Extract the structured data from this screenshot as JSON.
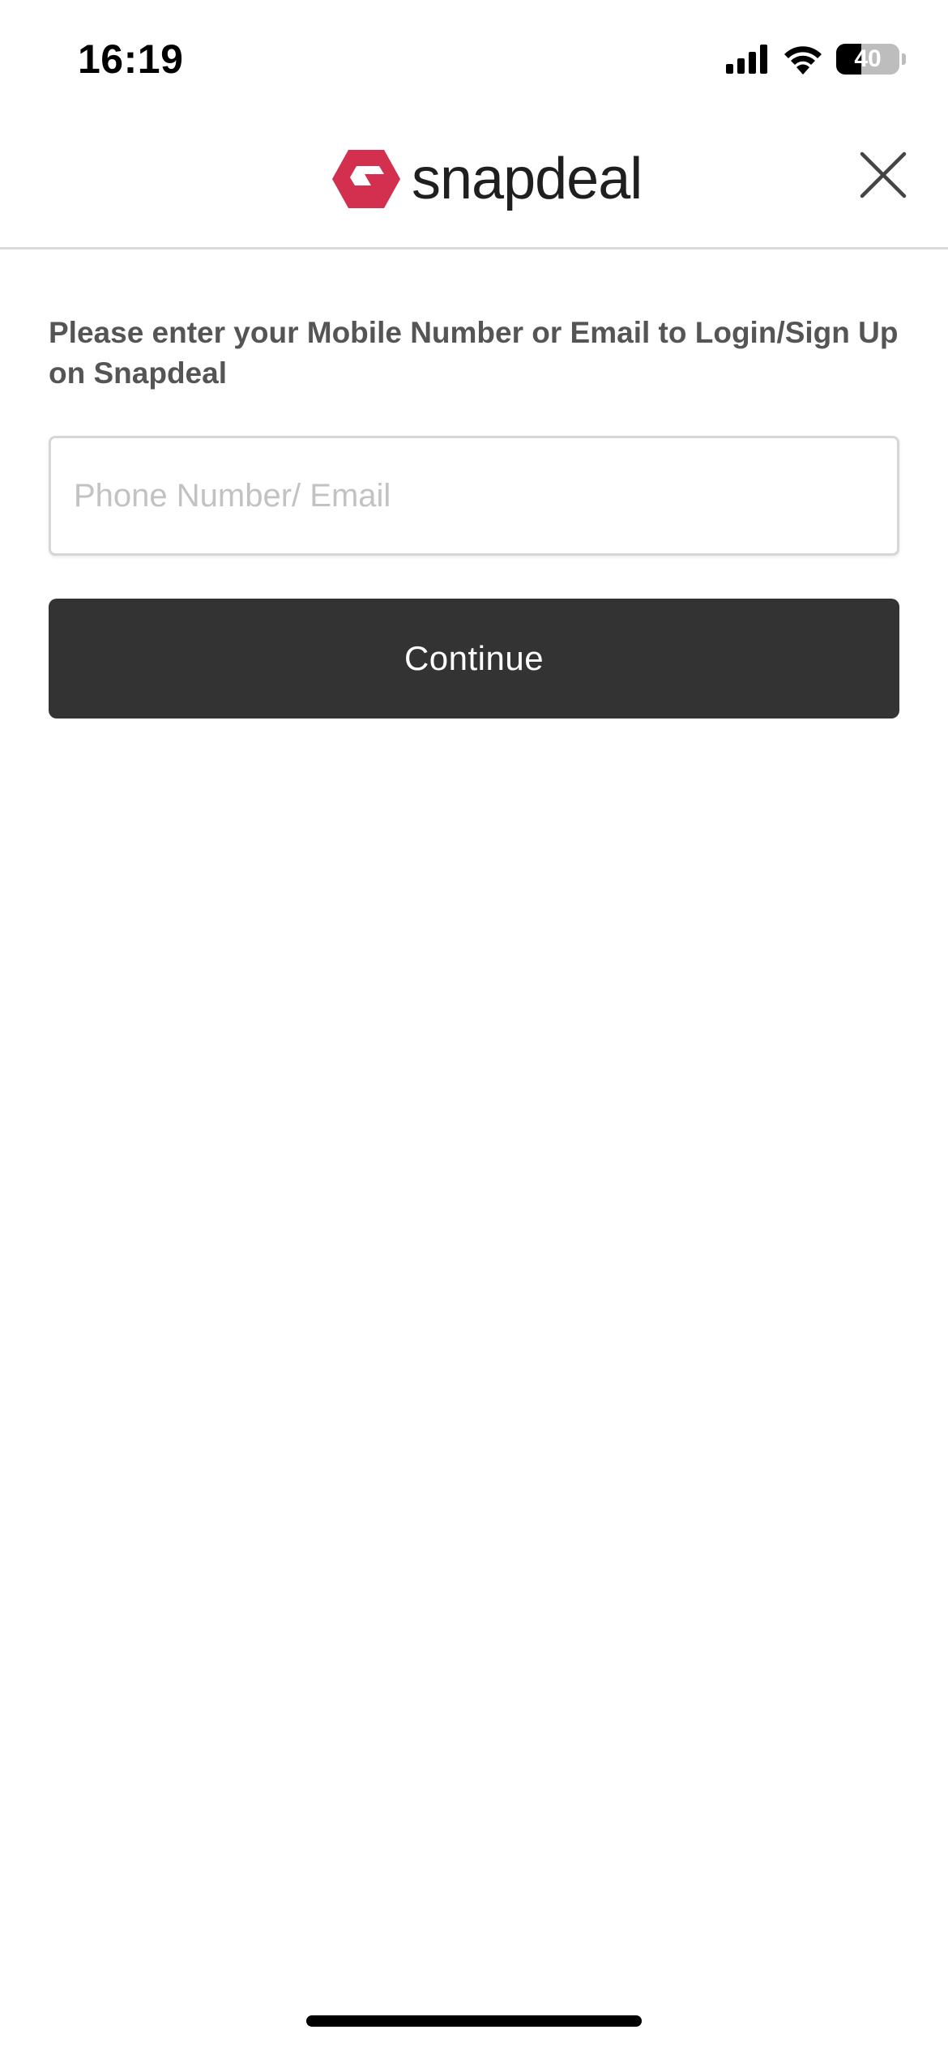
{
  "status_bar": {
    "time": "16:19",
    "battery_level": "40",
    "battery_fraction": 0.4,
    "icons": [
      "cellular-signal-icon",
      "wifi-icon",
      "battery-icon"
    ]
  },
  "header": {
    "logo_text": "snapdeal",
    "logo_color": "#d3304f",
    "close_icon": "close-icon"
  },
  "login": {
    "prompt": "Please enter your Mobile Number or Email to Login/Sign Up on Snapdeal",
    "input_value": "",
    "input_placeholder": "Phone Number/ Email",
    "continue_label": "Continue",
    "button_color": "#333333"
  }
}
